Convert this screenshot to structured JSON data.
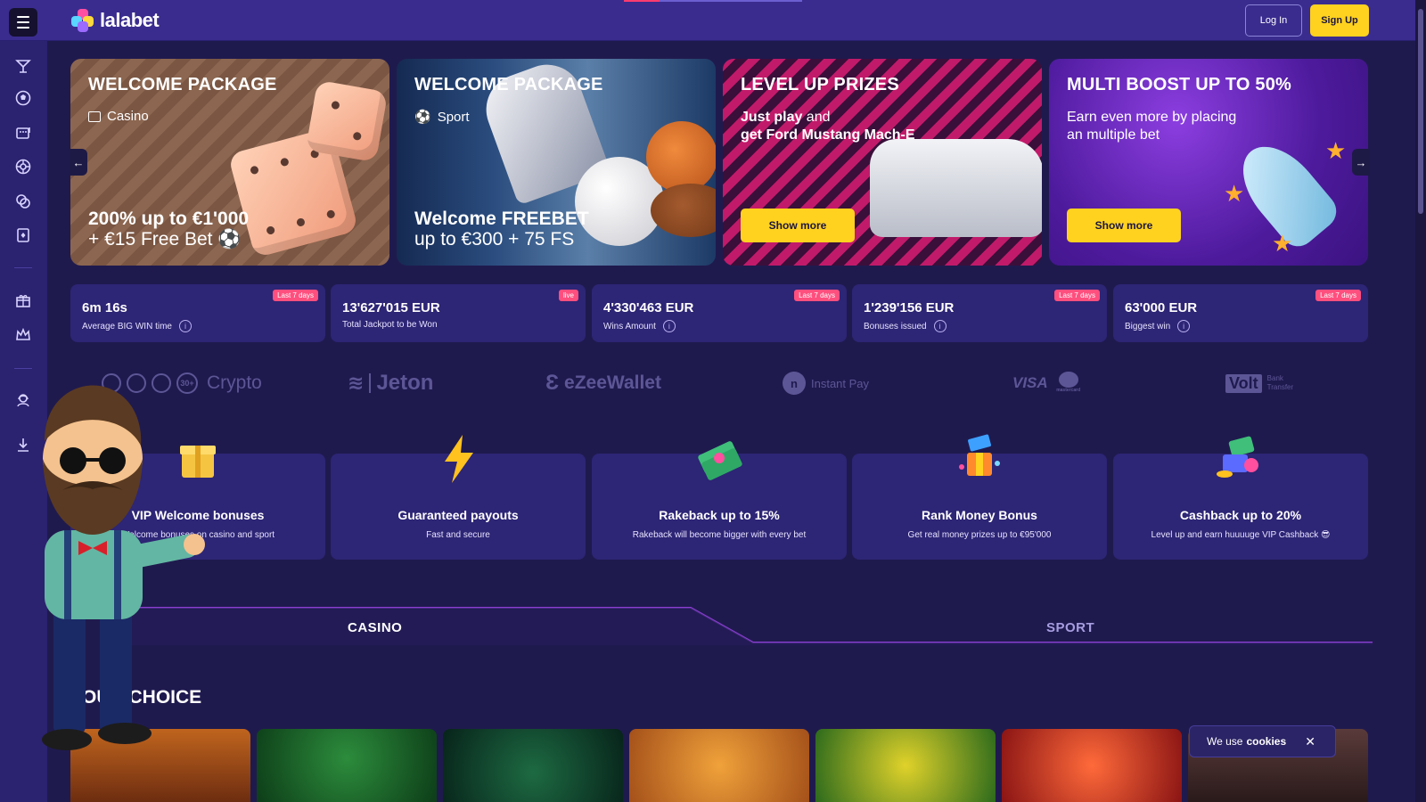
{
  "header": {
    "logo_text": "lalabet",
    "login_label": "Log In",
    "signup_label": "Sign Up"
  },
  "sidebar": {
    "icons": [
      "cocktail-icon",
      "football-icon",
      "slot-machine-icon",
      "roulette-icon",
      "chips-icon",
      "cards-icon",
      "gift-icon",
      "crown-icon",
      "support-icon",
      "download-icon"
    ]
  },
  "promos": [
    {
      "title": "WELCOME PACKAGE",
      "subtitle": "Casino",
      "line1": "200% up to €1'000",
      "line2": "+ €15 Free Bet ⚽"
    },
    {
      "title": "WELCOME PACKAGE",
      "subtitle": "Sport",
      "line1": "Welcome FREEBET",
      "line2": "up to €300 + 75 FS"
    },
    {
      "title": "LEVEL UP PRIZES",
      "desc_bold": "Just play",
      "desc_rest": " and",
      "desc_line2": "get Ford Mustang Mach-E",
      "button": "Show more"
    },
    {
      "title": "MULTI BOOST UP TO 50%",
      "desc": "Earn even more by placing an multiple bet",
      "button": "Show more"
    }
  ],
  "carousel": {
    "prev": "←",
    "next": "→"
  },
  "stats": [
    {
      "value": "6m 16s",
      "label": "Average BIG WIN time",
      "tag": "Last 7 days"
    },
    {
      "value": "13'627'015 EUR",
      "label": "Total Jackpot to be Won",
      "tag": "live"
    },
    {
      "value": "4'330'463 EUR",
      "label": "Wins Amount",
      "tag": "Last 7 days"
    },
    {
      "value": "1'239'156 EUR",
      "label": "Bonuses issued",
      "tag": "Last 7 days"
    },
    {
      "value": "63'000 EUR",
      "label": "Biggest win",
      "tag": "Last 7 days"
    }
  ],
  "payments": {
    "crypto_badge": "30+",
    "crypto": "Crypto",
    "jeton": "Jeton",
    "ezeewallet": "eZeeWallet",
    "instantpay": "Instant Pay",
    "visa": "VISA",
    "mastercard": "mastercard",
    "volt": "Volt",
    "bank_transfer": "Bank Transfer"
  },
  "features": [
    {
      "title": "VIP Welcome bonuses",
      "desc": "Welcome bonuses on casino and sport"
    },
    {
      "title": "Guaranteed payouts",
      "desc": "Fast and secure"
    },
    {
      "title": "Rakeback up to 15%",
      "desc": "Rakeback will become bigger with every bet"
    },
    {
      "title": "Rank Money Bonus",
      "desc": "Get real money prizes up to €95'000"
    },
    {
      "title": "Cashback up to 20%",
      "desc": "Level up and earn huuuuge VIP Cashback 😎"
    }
  ],
  "tabs": {
    "casino": "CASINO",
    "sport": "SPORT"
  },
  "section_title": "YOUR CHOICE",
  "games": [
    "buffalo-game",
    "royal-crown-game",
    "neon-dino-game",
    "elephant-game",
    "lucky-16-game",
    "hot-seven-game",
    "viking-game"
  ],
  "cookie": {
    "prefix": "We use",
    "link": "cookies",
    "close": "✕"
  },
  "colors": {
    "accent_yellow": "#ffd21f",
    "tag_pink": "#ff4f7e",
    "bg": "#1f1a4e",
    "topbar": "#3a2c8e"
  }
}
